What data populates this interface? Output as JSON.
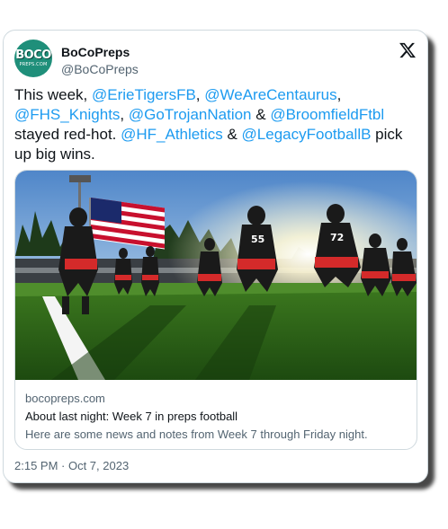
{
  "account": {
    "name": "BoCoPreps",
    "handle": "@BoCoPreps",
    "avatar_text": "BOCO",
    "avatar_subtext": "PREPS.COM"
  },
  "platform_icon": "x-logo-icon",
  "tweet": {
    "segments": [
      {
        "text": "This week, ",
        "type": "text"
      },
      {
        "text": "@ErieTigersFB",
        "type": "mention"
      },
      {
        "text": ", ",
        "type": "text"
      },
      {
        "text": "@WeAreCentaurus",
        "type": "mention"
      },
      {
        "text": ",",
        "type": "text"
      },
      {
        "text": "@FHS_Knights",
        "type": "mention"
      },
      {
        "text": ", ",
        "type": "text"
      },
      {
        "text": "@GoTrojanNation",
        "type": "mention"
      },
      {
        "text": " & ",
        "type": "text"
      },
      {
        "text": "@BroomfieldFtbl",
        "type": "mention"
      },
      {
        "text": "stayed red-hot. ",
        "type": "text"
      },
      {
        "text": "@HF_Athletics",
        "type": "mention"
      },
      {
        "text": " & ",
        "type": "text"
      },
      {
        "text": "@LegacyFootballB",
        "type": "mention"
      },
      {
        "text": " pick up big wins.",
        "type": "text"
      }
    ]
  },
  "link_card": {
    "domain": "bocopreps.com",
    "title": "About last night: Week 7 in preps football",
    "description": "Here are some news and notes from Week 7 through Friday night.",
    "image_alt": "Football players running onto field with American flag"
  },
  "timestamp": "2:15 PM · Oct 7, 2023",
  "colors": {
    "mention": "#1d9bf0",
    "text": "#0f1419",
    "secondary": "#536471",
    "border": "#cfd9de",
    "avatar": "#1f8f7a"
  }
}
